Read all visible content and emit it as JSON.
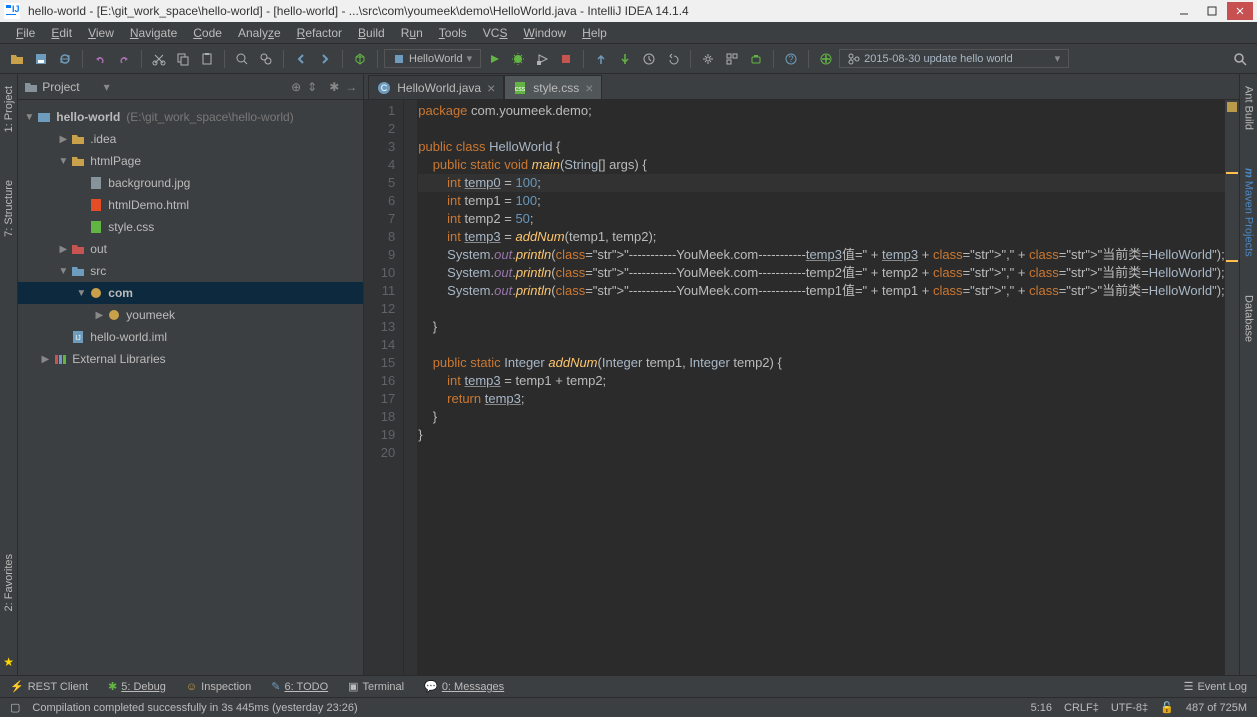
{
  "title": "hello-world - [E:\\git_work_space\\hello-world] - [hello-world] - ...\\src\\com\\youmeek\\demo\\HelloWorld.java - IntelliJ IDEA 14.1.4",
  "menubar": [
    "File",
    "Edit",
    "View",
    "Navigate",
    "Code",
    "Analyze",
    "Refactor",
    "Build",
    "Run",
    "Tools",
    "VCS",
    "Window",
    "Help"
  ],
  "toolbar": {
    "run_config": "HelloWorld",
    "vcs_label": "2015-08-30 update hello world"
  },
  "project": {
    "panel_title": "Project",
    "root": {
      "label": "hello-world",
      "path": "(E:\\git_work_space\\hello-world)"
    },
    "tree": [
      {
        "label": ".idea",
        "indent": 1,
        "arrow": "▶",
        "kind": "dir-orange"
      },
      {
        "label": "htmlPage",
        "indent": 1,
        "arrow": "▼",
        "kind": "dir-orange"
      },
      {
        "label": "background.jpg",
        "indent": 2,
        "arrow": "",
        "kind": "file"
      },
      {
        "label": "htmlDemo.html",
        "indent": 2,
        "arrow": "",
        "kind": "html"
      },
      {
        "label": "style.css",
        "indent": 2,
        "arrow": "",
        "kind": "css"
      },
      {
        "label": "out",
        "indent": 1,
        "arrow": "▶",
        "kind": "dir-red"
      },
      {
        "label": "src",
        "indent": 1,
        "arrow": "▼",
        "kind": "dir-blue"
      },
      {
        "label": "com",
        "indent": 2,
        "arrow": "▼",
        "kind": "package",
        "selected": true
      },
      {
        "label": "youmeek",
        "indent": 3,
        "arrow": "▶",
        "kind": "package"
      },
      {
        "label": "hello-world.iml",
        "indent": 1,
        "arrow": "",
        "kind": "iml"
      },
      {
        "label": "External Libraries",
        "indent": 0,
        "arrow": "▶",
        "kind": "lib"
      }
    ]
  },
  "left_tabs": [
    "1: Project",
    "7: Structure",
    "2: Favorites"
  ],
  "right_tabs": [
    "Ant Build",
    "Maven Projects",
    "Database"
  ],
  "editor": {
    "tabs": [
      {
        "label": "HelloWorld.java",
        "active": true
      },
      {
        "label": "style.css",
        "active": false
      }
    ],
    "lines": [
      "package com.youmeek.demo;",
      "",
      "public class HelloWorld {",
      "    public static void main(String[] args) {",
      "        int temp0 = 100;",
      "        int temp1 = 100;",
      "        int temp2 = 50;",
      "        int temp3 = addNum(temp1, temp2);",
      "        System.out.println(\"-----------YouMeek.com-----------temp3值=\" + temp3 + \",\" + \"当前类=HelloWorld\");",
      "        System.out.println(\"-----------YouMeek.com-----------temp2值=\" + temp2 + \",\" + \"当前类=HelloWorld\");",
      "        System.out.println(\"-----------YouMeek.com-----------temp1值=\" + temp1 + \",\" + \"当前类=HelloWorld\");",
      "",
      "    }",
      "",
      "    public static Integer addNum(Integer temp1, Integer temp2) {",
      "        int temp3 = temp1 + temp2;",
      "        return temp3;",
      "    }",
      "}",
      ""
    ],
    "line_count": 20,
    "cursor_line": 5
  },
  "bottom_tools": [
    "REST Client",
    "5: Debug",
    "Inspection",
    "6: TODO",
    "Terminal",
    "0: Messages"
  ],
  "bottom_right": "Event Log",
  "status": {
    "msg": "Compilation completed successfully in 3s 445ms (yesterday 23:26)",
    "pos": "5:16",
    "eol": "CRLF‡",
    "enc": "UTF-8‡",
    "mem": "487 of 725M"
  }
}
